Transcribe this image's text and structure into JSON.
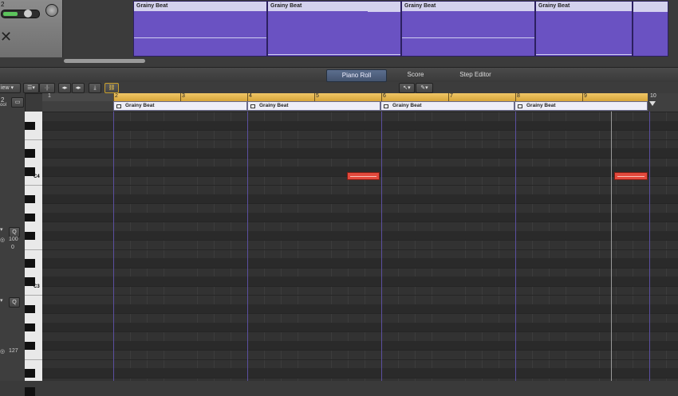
{
  "top": {
    "track_number": "2",
    "regions": [
      {
        "label": "Grainy Beat"
      },
      {
        "label": "Grainy Beat"
      },
      {
        "label": "Grainy Beat"
      },
      {
        "label": "Grainy Beat"
      },
      {
        "label": ""
      }
    ]
  },
  "tabs": {
    "piano_roll": "Piano Roll",
    "score": "Score",
    "step_editor": "Step Editor"
  },
  "toolbar": {
    "view_label": "iew"
  },
  "inspector": {
    "track_number": "2",
    "track_name_fragment": "ool",
    "quantize_label": "Q",
    "velocity_value": "100",
    "offset_value": "0",
    "quantize2_label": "Q",
    "velocity2_value": "127"
  },
  "ruler": {
    "bars": [
      "1",
      "2",
      "3",
      "4",
      "5",
      "6",
      "7",
      "8",
      "9",
      "10"
    ],
    "midi_regions": [
      {
        "label": "Grainy Beat"
      },
      {
        "label": "Grainy Beat"
      },
      {
        "label": "Grainy Beat"
      },
      {
        "label": "Grainy Beat"
      }
    ]
  },
  "keyboard": {
    "c4_label": "C4",
    "c3_label": "C3"
  },
  "colors": {
    "region": "#6a52c2",
    "ruler_bar": "#e2b24a",
    "note": "#e3493c",
    "active_tab": "#4e5f7e"
  }
}
